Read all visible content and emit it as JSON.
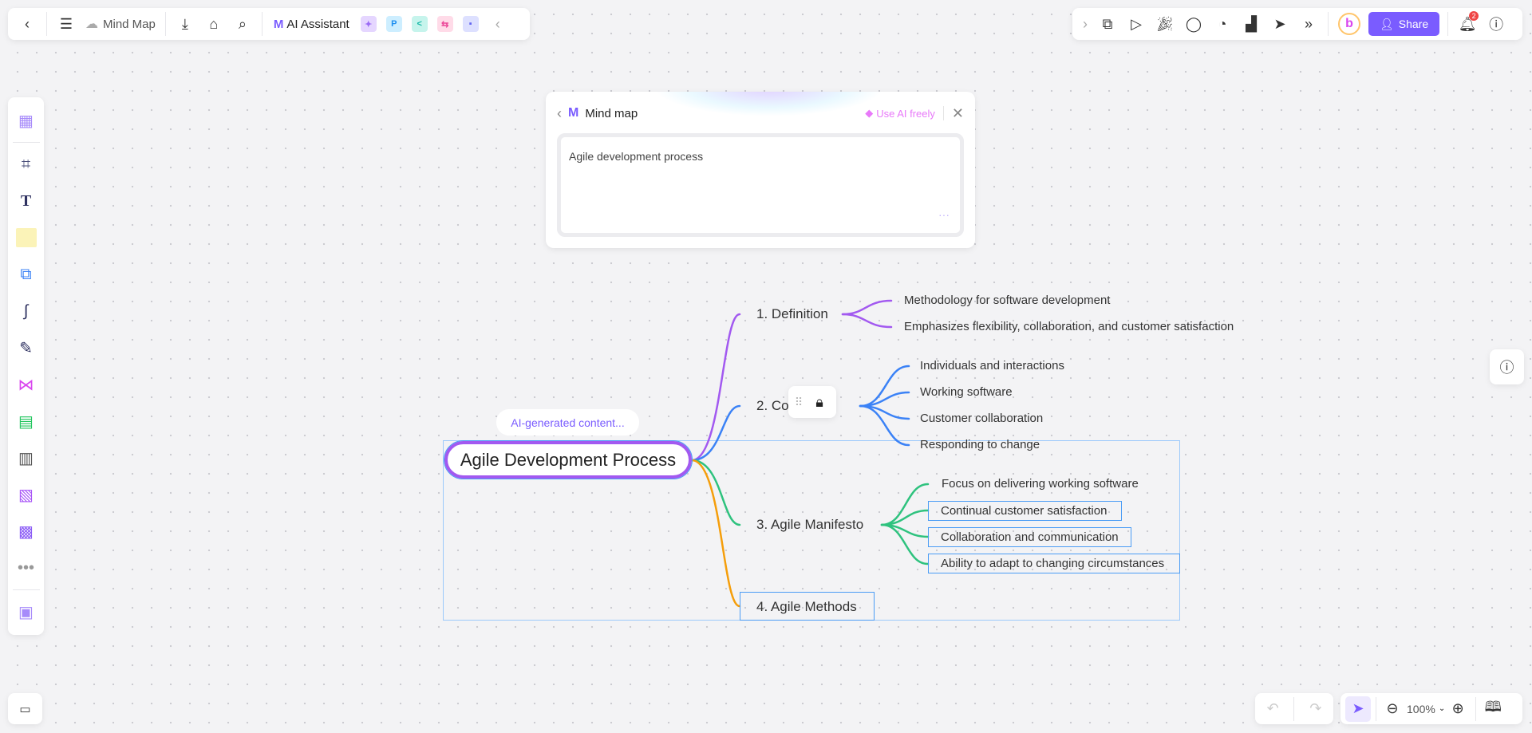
{
  "toolbar_left": {
    "doc_title": "Mind Map",
    "ai_assistant": "AI Assistant",
    "apps": [
      {
        "label": "",
        "color": "#c9a8ff",
        "icon": "image-ai-icon"
      },
      {
        "label": "P",
        "color": "#bfe6ff",
        "icon": "p-app-icon"
      },
      {
        "label": "<",
        "color": "#b7f2ea",
        "icon": "mindmap-app-icon"
      },
      {
        "label": "⇆",
        "color": "#ffd3e4",
        "icon": "flow-app-icon"
      },
      {
        "label": "▪",
        "color": "#d9dcff",
        "icon": "chat-app-icon"
      }
    ]
  },
  "toolbar_right": {
    "share_label": "Share",
    "notification_count": "2",
    "accent": "#7a5cff"
  },
  "ai_dialog": {
    "title": "Mind map",
    "use_ai_label": "Use AI freely",
    "prompt": "Agile development process",
    "more": "···"
  },
  "mindmap": {
    "ai_label": "AI-generated content...",
    "root": "Agile Development Process",
    "branches": [
      {
        "label": "1. Definition",
        "color": "#a259f0",
        "children": [
          "Methodology for software development",
          "Emphasizes flexibility, collaboration, and customer satisfaction"
        ]
      },
      {
        "label_start": "2. Co",
        "label_end": "s",
        "color": "#3b82f6",
        "children": [
          "Individuals and interactions",
          "Working software",
          "Customer collaboration",
          "Responding to change"
        ]
      },
      {
        "label": "3. Agile Manifesto",
        "color": "#2ec27e",
        "children": [
          "Focus on delivering working software",
          "Continual customer satisfaction",
          "Collaboration and communication",
          "Ability to adapt to changing circumstances"
        ]
      },
      {
        "label": "4. Agile Methods",
        "color": "#f59e0b",
        "children": []
      }
    ]
  },
  "bottom": {
    "zoom_level": "100%"
  }
}
